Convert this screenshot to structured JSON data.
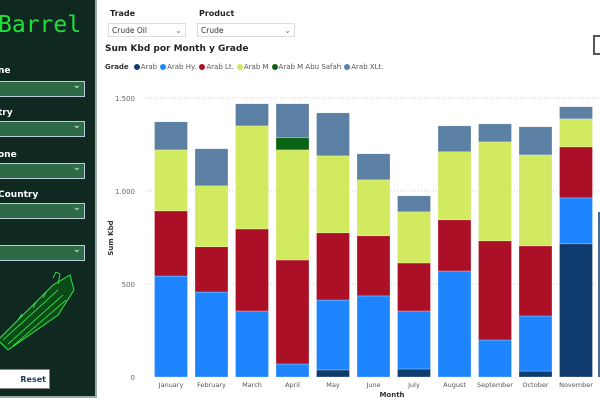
{
  "sidebar": {
    "brand": "Barrel",
    "filters": [
      {
        "label": "ne"
      },
      {
        "label": "try"
      },
      {
        "label": "one"
      },
      {
        "label": "Country"
      },
      {
        "label": ""
      }
    ],
    "reset_label": "Reset Filters"
  },
  "slicers": {
    "trade": {
      "label": "Trade",
      "value": "Crude Oil"
    },
    "product": {
      "label": "Product",
      "value": "Crude"
    }
  },
  "colors": {
    "Arab": "#0f3b6e",
    "Arab Hy.": "#1e85ff",
    "Arab Lt.": "#ab1026",
    "Arab M": "#d2ea60",
    "Arab M Abu Safah": "#0b6416",
    "Arab XLt.": "#5b80a3"
  },
  "chart_data": {
    "type": "bar",
    "stacked": true,
    "title": "Sum Kbd por Month y Grade",
    "legend_title": "Grade",
    "legend_position": "top-left",
    "xlabel": "Month",
    "ylabel": "Sum Kbd",
    "ylim": [
      0,
      1500
    ],
    "yticks": [
      0,
      500,
      1000,
      1500
    ],
    "ytick_labels": [
      "0",
      "500",
      "1.000",
      "1.500"
    ],
    "grid": true,
    "categories": [
      "January",
      "February",
      "March",
      "April",
      "May",
      "June",
      "July",
      "August",
      "September",
      "October",
      "November"
    ],
    "series": [
      {
        "name": "Arab",
        "values": [
          0,
          0,
          0,
          0,
          38,
          0,
          43,
          0,
          0,
          32,
          716
        ]
      },
      {
        "name": "Arab Hy.",
        "values": [
          543,
          457,
          355,
          70,
          376,
          436,
          312,
          570,
          199,
          296,
          247
        ]
      },
      {
        "name": "Arab Lt.",
        "values": [
          350,
          243,
          441,
          559,
          361,
          323,
          258,
          275,
          533,
          377,
          274
        ]
      },
      {
        "name": "Arab M",
        "values": [
          328,
          328,
          554,
          592,
          414,
          301,
          275,
          366,
          532,
          489,
          151
        ]
      },
      {
        "name": "Arab M Abu Safah",
        "values": [
          0,
          0,
          0,
          65,
          0,
          0,
          0,
          0,
          0,
          0,
          0
        ]
      },
      {
        "name": "Arab XLt.",
        "values": [
          151,
          199,
          119,
          183,
          231,
          140,
          86,
          139,
          97,
          151,
          65
        ]
      }
    ]
  }
}
